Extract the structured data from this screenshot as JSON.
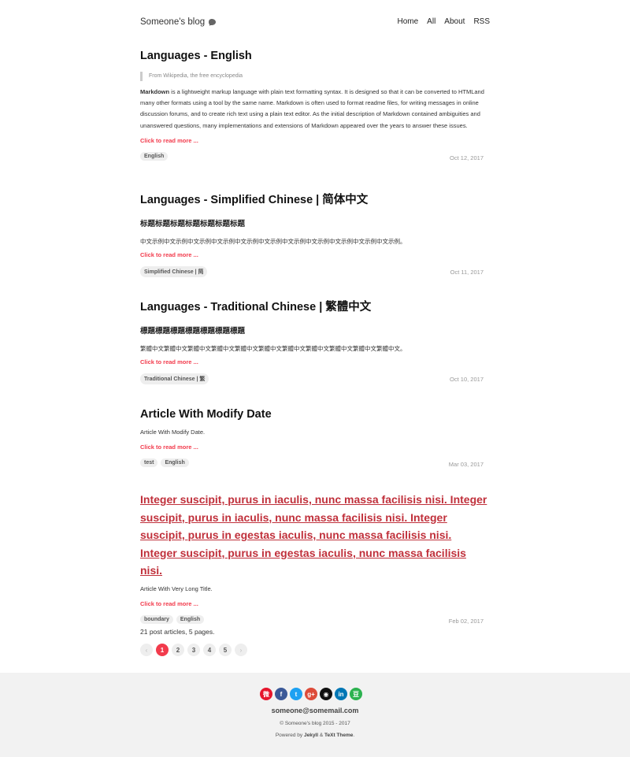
{
  "header": {
    "blog_title": "Someone's blog",
    "logo_icon": "blog-logo-icon",
    "nav": [
      "Home",
      "All",
      "About",
      "RSS"
    ]
  },
  "posts": [
    {
      "title": "Languages - English",
      "quote": "From Wikipedia, the free encyclopedia",
      "excerpt_bold": "Markdown",
      "excerpt": " is a lightweight markup language with plain text formatting syntax. It is designed so that it can be converted to HTMLand many other formats using a tool by the same name. Markdown is often used to format readme files, for writing messages in online discussion forums, and to create rich text using a plain text editor. As the initial description of Markdown contained ambiguities and unanswered questions, many implementations and extensions of Markdown appeared over the years to answer these issues.",
      "read_more": "Click to read more ...",
      "tags": [
        "English"
      ],
      "date": "Oct 12, 2017"
    },
    {
      "title": "Languages - Simplified Chinese | 简体中文",
      "subhead": "标题标题标题标题标题标题标题",
      "excerpt": "中文示例中文示例中文示例中文示例中文示例中文示例中文示例中文示例中文示例中文示例中文示例。",
      "read_more": "Click to read more ...",
      "tags": [
        "Simplified Chinese | 简"
      ],
      "date": "Oct 11, 2017"
    },
    {
      "title": "Languages - Traditional Chinese | 繁體中文",
      "subhead": "標題標題標題標題標題標題標題",
      "excerpt": "繁體中文繁體中文繁體中文繁體中文繁體中文繁體中文繁體中文繁體中文繁體中文繁體中文繁體中文。",
      "read_more": "Click to read more ...",
      "tags": [
        "Traditional Chinese | 繁"
      ],
      "date": "Oct 10, 2017"
    },
    {
      "title": "Article With Modify Date",
      "excerpt": "Article With Modify Date.",
      "read_more": "Click to read more ...",
      "tags": [
        "test",
        "English"
      ],
      "date": "Mar 03, 2017"
    },
    {
      "title": "Integer suscipit, purus in iaculis, nunc massa facilisis nisi. Integer suscipit, purus in iaculis, nunc massa facilisis nisi. Integer suscipit, purus in egestas iaculis, nunc massa facilisis nisi. Integer suscipit, purus in egestas iaculis, nunc massa facilisis nisi.",
      "excerpt": "Article With Very Long Title.",
      "read_more": "Click to read more ...",
      "tags": [
        "boundary",
        "English"
      ],
      "date": "Feb 02, 2017"
    }
  ],
  "pagination": {
    "summary": "21 post articles, 5 pages.",
    "prev": "‹",
    "next": "›",
    "pages": [
      "1",
      "2",
      "3",
      "4",
      "5"
    ],
    "current": "1"
  },
  "footer": {
    "social": [
      {
        "name": "weibo-icon",
        "glyph": "微",
        "color": "#e6162d"
      },
      {
        "name": "facebook-icon",
        "glyph": "f",
        "color": "#3b5998"
      },
      {
        "name": "twitter-icon",
        "glyph": "t",
        "color": "#1da1f2"
      },
      {
        "name": "google-plus-icon",
        "glyph": "g+",
        "color": "#dd4b39"
      },
      {
        "name": "github-icon",
        "glyph": "◉",
        "color": "#111111"
      },
      {
        "name": "linkedin-icon",
        "glyph": "in",
        "color": "#0077b5"
      },
      {
        "name": "douban-icon",
        "glyph": "豆",
        "color": "#2cb24f"
      }
    ],
    "email": "someone@somemail.com",
    "copyright": "© Someone's blog 2015 - 2017",
    "powered_prefix": "Powered by ",
    "powered_jekyll": "Jekyll",
    "powered_amp": " & ",
    "powered_theme": "TeXt Theme",
    "powered_suffix": "."
  }
}
